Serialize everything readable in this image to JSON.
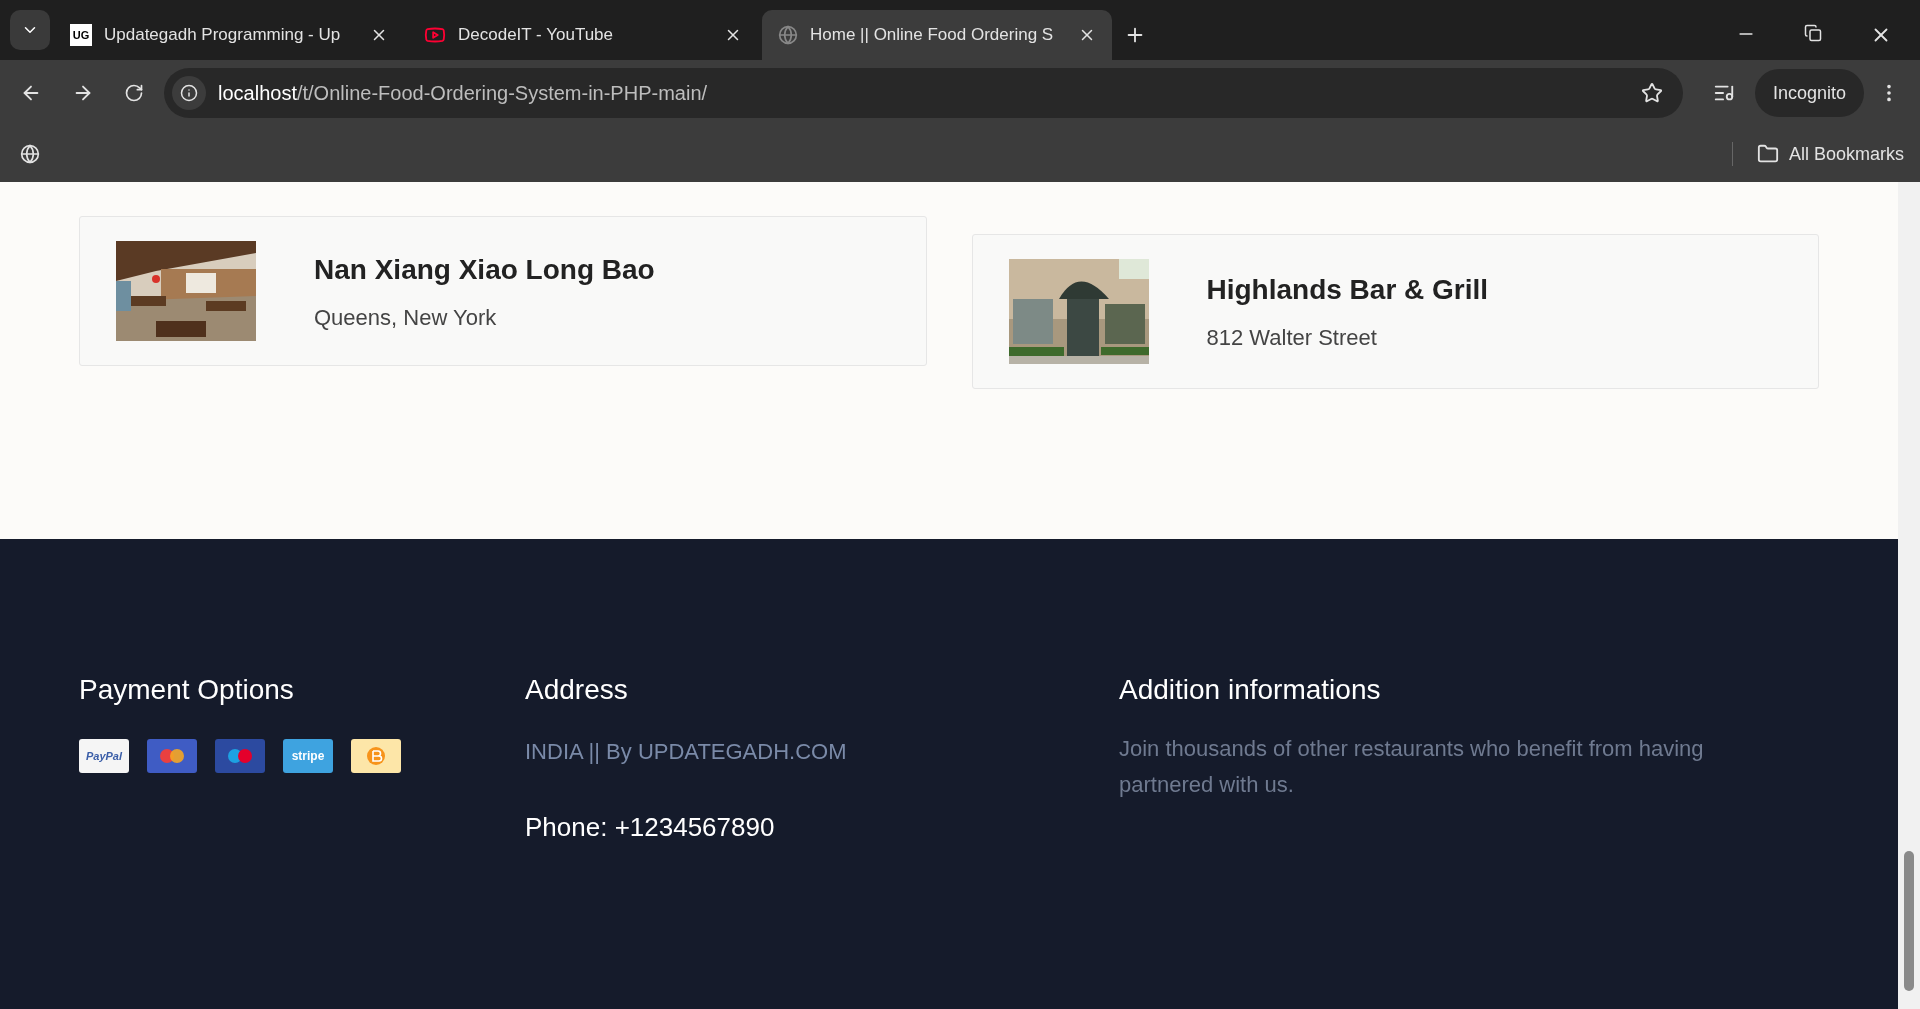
{
  "browser": {
    "tabs": [
      {
        "title": "Updategadh Programming - Up",
        "favicon": "UG",
        "selected": false
      },
      {
        "title": "DecodeIT - YouTube",
        "selected": false
      },
      {
        "title": "Home || Online Food Ordering S",
        "selected": true
      }
    ],
    "address": {
      "host": "localhost",
      "path": "/t/Online-Food-Ordering-System-in-PHP-main/"
    },
    "profile": "Incognito",
    "bookmarks": "All Bookmarks"
  },
  "restaurants": [
    {
      "name": "Nan Xiang Xiao Long Bao",
      "address": "Queens, New York",
      "kind": "interior"
    },
    {
      "name": "Highlands Bar & Grill",
      "address": "812 Walter Street",
      "kind": "storefront"
    }
  ],
  "footer": {
    "payment": {
      "title": "Payment Options",
      "methods": [
        {
          "kind": "paypal",
          "label": "PayPal"
        },
        {
          "kind": "mastercard"
        },
        {
          "kind": "maestro"
        },
        {
          "kind": "stripe",
          "label": "stripe"
        },
        {
          "kind": "bitcoin"
        }
      ]
    },
    "address": {
      "title": "Address",
      "text": "INDIA || By UPDATEGADH.COM",
      "phone": "Phone: +1234567890"
    },
    "info": {
      "title": "Addition informations",
      "text": "Join thousands of other restaurants who benefit from having partnered with us."
    }
  }
}
